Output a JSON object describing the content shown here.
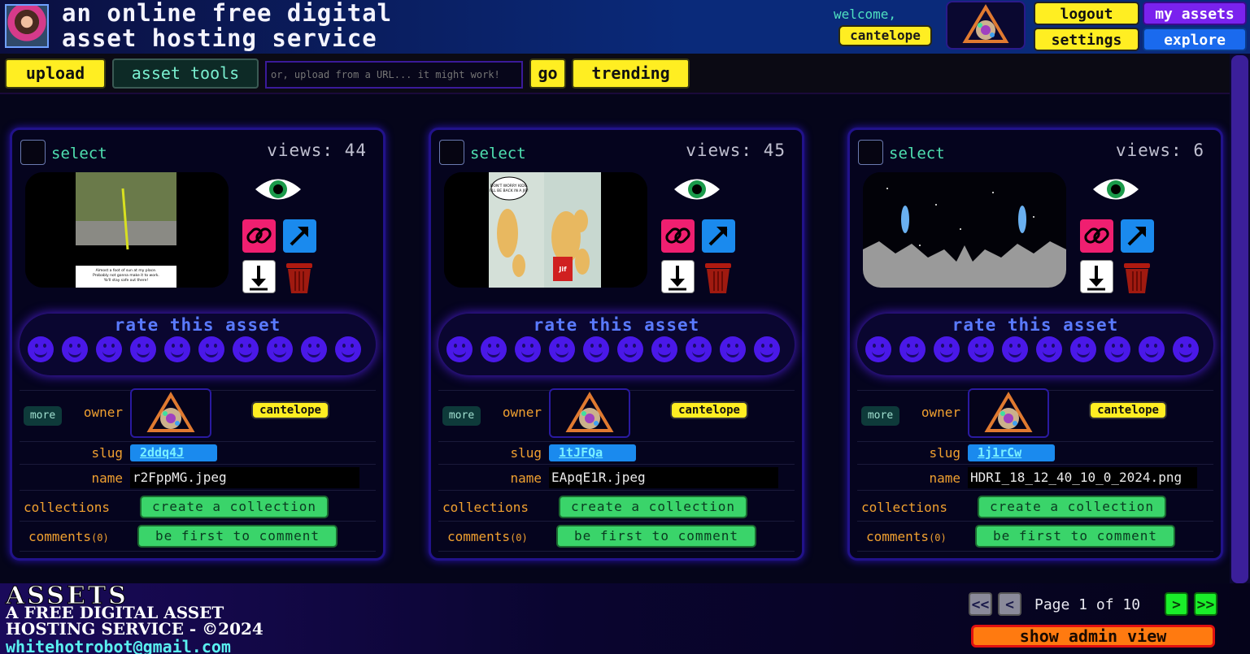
{
  "header": {
    "title_line1": "an online free digital",
    "title_line2": "asset hosting service",
    "welcome": "welcome,",
    "username": "cantelope",
    "logout": "logout",
    "my_assets": "my assets",
    "settings": "settings",
    "explore": "explore"
  },
  "toolbar": {
    "upload": "upload",
    "asset_tools": "asset tools",
    "url_placeholder": "or, upload from a URL... it might work!",
    "go": "go",
    "trending": "trending"
  },
  "card_labels": {
    "select": "select",
    "views_prefix": "views:",
    "rate": "rate this asset",
    "more": "more",
    "owner": "owner",
    "slug": "slug",
    "name": "name",
    "collections": "collections",
    "comments": "comments",
    "create_collection": "create a collection",
    "first_comment": "be first to comment"
  },
  "assets": [
    {
      "views": "44",
      "owner": "cantelope",
      "slug": "2ddq4J",
      "name": "r2FppMG.jpeg",
      "comments_count": "(0)",
      "caption": "Almost a foot of sun at my place. Probably not gonna make it to work. Ya'll stay safe out there!"
    },
    {
      "views": "45",
      "owner": "cantelope",
      "slug": "1tJFQa",
      "name": "EApqE1R.jpeg",
      "comments_count": "(0)",
      "caption": "DON'T WORRY KIDS, I'LL BE BACK IN A JIF!"
    },
    {
      "views": "6",
      "owner": "cantelope",
      "slug": "1j1rCw",
      "name": "HDRI_18_12_40_10_0_2024.png",
      "comments_count": "(0)",
      "caption": ""
    }
  ],
  "footer": {
    "title": "ASSETS",
    "line1": "A FREE DIGITAL ASSET",
    "line2": "HOSTING SERVICE - ©2024",
    "email": "whitehotrobot@gmail.com",
    "first": "<<",
    "prev": "<",
    "page_info": "Page 1 of 10",
    "next": ">",
    "last": ">>",
    "admin": "show admin view"
  },
  "colors": {
    "accent_yellow": "#ffee22",
    "accent_purple": "#7a22ee",
    "accent_blue": "#1a6aee",
    "rate_purple": "#4a18e8",
    "button_green": "#3ad46a"
  }
}
